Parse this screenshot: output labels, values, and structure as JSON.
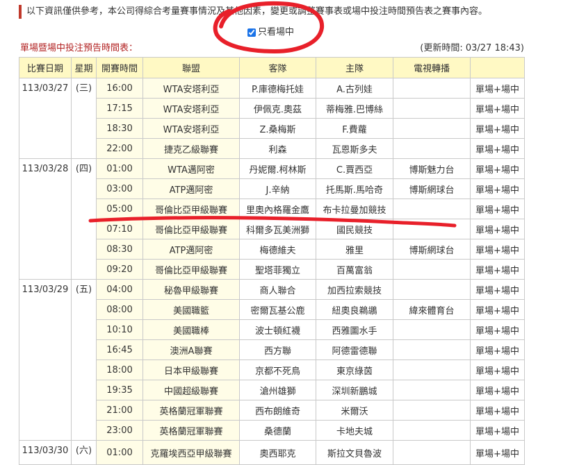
{
  "notice": "以下資訊僅供參考，本公司得綜合考量賽事情況及其他因素，變更或調整賽事表或場中投注時間預告表之賽事內容。",
  "filter": {
    "label": "只看場中",
    "checked": true
  },
  "table_title": "單場暨場中投注預告時間表：",
  "updated": "(更新時間: 03/27 18:43)",
  "headers": [
    "比賽日期",
    "星期",
    "開賽時間",
    "聯盟",
    "客隊",
    "主隊",
    "電視轉播",
    ""
  ],
  "rows": [
    {
      "date": "113/03/27",
      "weekday": "(三)",
      "rowspan": 4,
      "time": "16:00",
      "league": "WTA安塔利亞",
      "away": "P.庫德梅托娃",
      "home": "A.古列娃",
      "tv": "",
      "bet": "單場+場中"
    },
    {
      "time": "17:15",
      "league": "WTA安塔利亞",
      "away": "伊佩克.奧茲",
      "home": "蒂梅雅.巴博絲",
      "tv": "",
      "bet": "單場+場中"
    },
    {
      "time": "18:30",
      "league": "WTA安塔利亞",
      "away": "Z.桑梅斯",
      "home": "F.費蘿",
      "tv": "",
      "bet": "單場+場中"
    },
    {
      "time": "22:00",
      "league": "捷克乙級聯賽",
      "away": "利森",
      "home": "瓦恩斯多夫",
      "tv": "",
      "bet": "單場+場中"
    },
    {
      "date": "113/03/28",
      "weekday": "(四)",
      "rowspan": 6,
      "time": "01:00",
      "league": "WTA邁阿密",
      "away": "丹妮爾.柯林斯",
      "home": "C.賈西亞",
      "tv": "博斯魅力台",
      "bet": "單場+場中"
    },
    {
      "time": "03:00",
      "league": "ATP邁阿密",
      "away": "J.辛納",
      "home": "托馬斯.馬哈奇",
      "tv": "博斯網球台",
      "bet": "單場+場中"
    },
    {
      "time": "05:00",
      "league": "哥倫比亞甲級聯賽",
      "away": "里奧內格羅金鷹",
      "home": "布卡拉曼加競技",
      "tv": "",
      "bet": "單場+場中"
    },
    {
      "time": "07:10",
      "league": "哥倫比亞甲級聯賽",
      "away": "科爾多瓦美洲獅",
      "home": "國民競技",
      "tv": "",
      "bet": "單場+場中"
    },
    {
      "time": "08:30",
      "league": "ATP邁阿密",
      "away": "梅德維夫",
      "home": "雅里",
      "tv": "博斯網球台",
      "bet": "單場+場中"
    },
    {
      "time": "09:20",
      "league": "哥倫比亞甲級聯賽",
      "away": "聖塔菲獨立",
      "home": "百萬富翁",
      "tv": "",
      "bet": "單場+場中"
    },
    {
      "date": "113/03/29",
      "weekday": "(五)",
      "rowspan": 8,
      "time": "04:00",
      "league": "秘魯甲級聯賽",
      "away": "商人聯合",
      "home": "加西拉索競技",
      "tv": "",
      "bet": "單場+場中"
    },
    {
      "time": "08:00",
      "league": "美國職籃",
      "away": "密爾瓦基公鹿",
      "home": "紐奧良鵜鶘",
      "tv": "緯來體育台",
      "bet": "單場+場中"
    },
    {
      "time": "10:10",
      "league": "美國職棒",
      "away": "波士頓紅襪",
      "home": "西雅圖水手",
      "tv": "",
      "bet": "單場+場中"
    },
    {
      "time": "16:45",
      "league": "澳洲A聯賽",
      "away": "西方聯",
      "home": "阿德雷德聯",
      "tv": "",
      "bet": "單場+場中"
    },
    {
      "time": "18:00",
      "league": "日本甲級聯賽",
      "away": "京都不死鳥",
      "home": "東京綠茵",
      "tv": "",
      "bet": "單場+場中"
    },
    {
      "time": "19:35",
      "league": "中國超級聯賽",
      "away": "滄州雄獅",
      "home": "深圳新鵬城",
      "tv": "",
      "bet": "單場+場中"
    },
    {
      "time": "21:00",
      "league": "英格蘭冠軍聯賽",
      "away": "西布朗維奇",
      "home": "米爾沃",
      "tv": "",
      "bet": "單場+場中"
    },
    {
      "time": "23:00",
      "league": "英格蘭冠軍聯賽",
      "away": "桑德蘭",
      "home": "卡地夫城",
      "tv": "",
      "bet": "單場+場中"
    },
    {
      "date": "113/03/30",
      "weekday": "(六)",
      "rowspan": 1,
      "time": "01:00",
      "league": "克羅埃西亞甲級聯賽",
      "away": "奧西耶克",
      "home": "斯拉文貝魯波",
      "tv": "",
      "bet": "單場+場中"
    }
  ],
  "annotation_color": "#e8202a"
}
